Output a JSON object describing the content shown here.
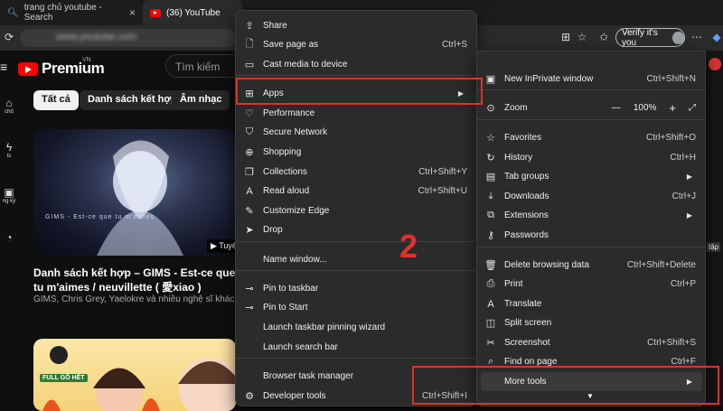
{
  "browser": {
    "tabs": [
      {
        "title": "trang chủ youtube - Search",
        "icon": "search-icon"
      },
      {
        "title": "(36) YouTube",
        "icon": "youtube-icon"
      }
    ],
    "url": "www.youtube.com",
    "verify_label": "Verify it's you"
  },
  "youtube": {
    "logo_text": "Premium",
    "logo_region": "VN",
    "search_placeholder": "Tìm kiếm",
    "chips": [
      "Tất cả",
      "Danh sách kết hợp",
      "Âm nhạc"
    ],
    "sidebar": [
      "chủ",
      "ts",
      "ng ký"
    ],
    "video1": {
      "title": "Danh sách kết hợp – GIMS - Est-ce que tu m'aimes / neuvillette ( 愛xiao )",
      "subtitle": "GIMS, Chris Grey, Yaelokre và nhiều nghệ sĩ khác",
      "thumb_caption": "GIMS - Est-ce que tu m'aimes",
      "badge": "Tuyể"
    },
    "video2": {
      "badge": "FULL GỖ HẾT"
    },
    "right_badge": "tập"
  },
  "menu_main": {
    "items": [
      {
        "label": "Share",
        "shortcut": "",
        "icon": "share-icon"
      },
      {
        "label": "Save page as",
        "shortcut": "Ctrl+S",
        "icon": "save-page-icon"
      },
      {
        "label": "Cast media to device",
        "shortcut": "",
        "icon": "cast-icon"
      },
      {
        "label": "Apps",
        "shortcut": "",
        "icon": "apps-icon",
        "submenu": true
      },
      {
        "label": "Performance",
        "shortcut": "",
        "icon": "performance-icon"
      },
      {
        "label": "Secure Network",
        "shortcut": "",
        "icon": "secure-network-icon"
      },
      {
        "label": "Shopping",
        "shortcut": "",
        "icon": "shopping-icon"
      },
      {
        "label": "Collections",
        "shortcut": "Ctrl+Shift+Y",
        "icon": "collections-icon"
      },
      {
        "label": "Read aloud",
        "shortcut": "Ctrl+Shift+U",
        "icon": "read-aloud-icon"
      },
      {
        "label": "Customize Edge",
        "shortcut": "",
        "icon": "customize-icon"
      },
      {
        "label": "Drop",
        "shortcut": "",
        "icon": "drop-icon"
      },
      {
        "label": "Name window...",
        "shortcut": "",
        "icon": ""
      },
      {
        "label": "Pin to taskbar",
        "shortcut": "",
        "icon": "pin-icon"
      },
      {
        "label": "Pin to Start",
        "shortcut": "",
        "icon": "pin-start-icon"
      },
      {
        "label": "Launch taskbar pinning wizard",
        "shortcut": "",
        "icon": ""
      },
      {
        "label": "Launch search bar",
        "shortcut": "",
        "icon": ""
      },
      {
        "label": "Browser task manager",
        "shortcut": "",
        "icon": ""
      },
      {
        "label": "Developer tools",
        "shortcut": "Ctrl+Shift+I",
        "icon": "developer-tools-icon"
      }
    ]
  },
  "menu_edge": {
    "items": [
      {
        "label": "New InPrivate window",
        "shortcut": "Ctrl+Shift+N",
        "icon": "inprivate-icon"
      },
      {
        "label": "Zoom",
        "shortcut": "",
        "icon": "zoom-icon"
      },
      {
        "label": "Favorites",
        "shortcut": "Ctrl+Shift+O",
        "icon": "favorites-icon"
      },
      {
        "label": "History",
        "shortcut": "Ctrl+H",
        "icon": "history-icon"
      },
      {
        "label": "Tab groups",
        "shortcut": "",
        "icon": "tab-groups-icon",
        "submenu": true
      },
      {
        "label": "Downloads",
        "shortcut": "Ctrl+J",
        "icon": "downloads-icon"
      },
      {
        "label": "Extensions",
        "shortcut": "",
        "icon": "extensions-icon",
        "submenu": true
      },
      {
        "label": "Passwords",
        "shortcut": "",
        "icon": "passwords-icon"
      },
      {
        "label": "Delete browsing data",
        "shortcut": "Ctrl+Shift+Delete",
        "icon": "delete-icon"
      },
      {
        "label": "Print",
        "shortcut": "Ctrl+P",
        "icon": "print-icon"
      },
      {
        "label": "Translate",
        "shortcut": "",
        "icon": "translate-icon"
      },
      {
        "label": "Split screen",
        "shortcut": "",
        "icon": "split-screen-icon"
      },
      {
        "label": "Screenshot",
        "shortcut": "Ctrl+Shift+S",
        "icon": "screenshot-icon"
      },
      {
        "label": "Find on page",
        "shortcut": "Ctrl+F",
        "icon": "find-icon"
      },
      {
        "label": "More tools",
        "shortcut": "",
        "icon": "",
        "submenu": true
      }
    ],
    "zoom_value": "100%",
    "zoom_minus": "—",
    "zoom_plus": "+"
  },
  "annotation": {
    "step": "2"
  },
  "colors": {
    "accent_red": "#e0312c",
    "menu_bg": "#2b2b2b",
    "page_bg": "#0f0f0f"
  }
}
